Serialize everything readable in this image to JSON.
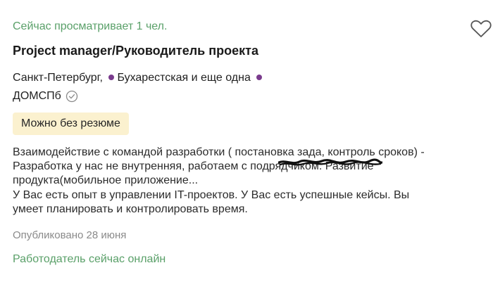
{
  "colors": {
    "accent_green": "#5aa069",
    "metro_purple": "#7a3b8d",
    "badge_bg": "#fbf1cf"
  },
  "vacancy": {
    "viewers_text": "Сейчас просматривает 1 чел.",
    "title": "Project manager/Руководитель проекта",
    "city": "Санкт-Петербург,",
    "metro_text": "Бухарестская и еще одна",
    "company": "ДОМСПб",
    "no_resume_badge": "Можно без резюме",
    "description_lines": [
      "Взаимодействие с командой разработки ( постановка зада, контроль сроков) -",
      "Разработка у нас не внутренняя, работаем с подрядчиком. Развитие",
      "продукта(мобильное приложение...",
      "У Вас есть опыт в управлении IT-проектов. У Вас есть успешные кейсы. Вы",
      "умеет планировать и контролировать время."
    ],
    "published": "Опубликовано 28 июня",
    "employer_online": "Работодатель сейчас онлайн"
  },
  "icons": {
    "favorite": "heart-outline-icon",
    "verified": "check-circle-icon",
    "metro": "metro-dot-icon"
  }
}
